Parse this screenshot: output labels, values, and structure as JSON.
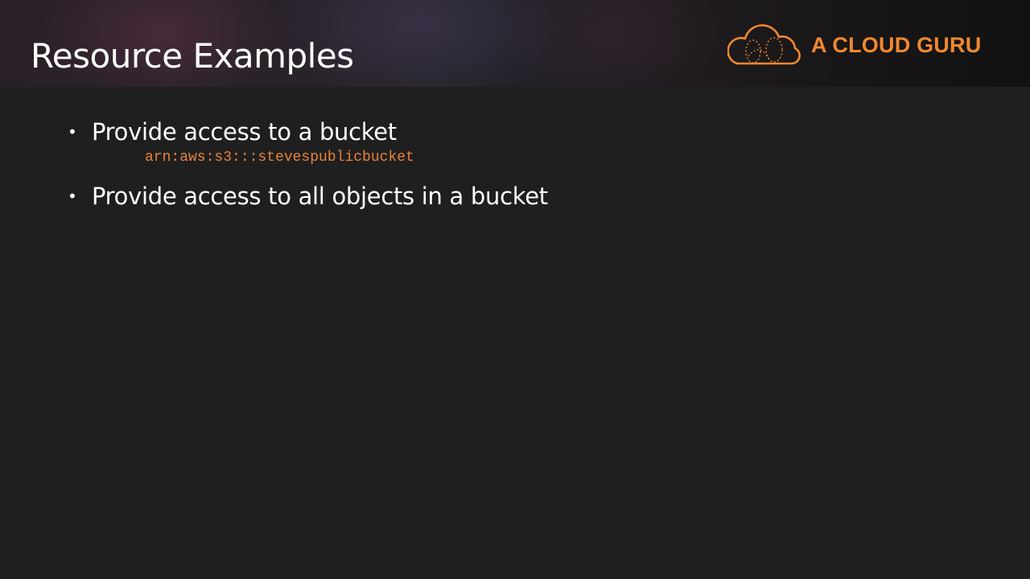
{
  "slide": {
    "title": "Resource Examples",
    "logo": {
      "icon": "cloud-logo-icon",
      "text": "A CLOUD GURU",
      "color": "#f0892f"
    },
    "bullets": [
      {
        "text": "Provide access to a bucket",
        "code": "arn:aws:s3:::stevespublicbucket"
      },
      {
        "text": "Provide access to all objects in a bucket"
      }
    ],
    "bullet_glyph": "•",
    "colors": {
      "background": "#1f1f1f",
      "text": "#ffffff",
      "code": "#e8823a"
    }
  }
}
